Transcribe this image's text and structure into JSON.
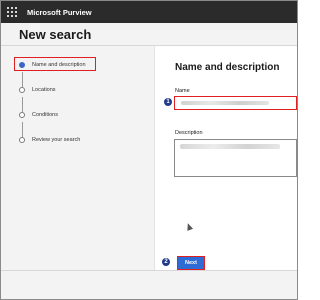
{
  "header": {
    "app_title": "Microsoft Purview"
  },
  "page": {
    "title": "New search"
  },
  "steps": [
    {
      "label": "Name and description",
      "active": true
    },
    {
      "label": "Locations",
      "active": false
    },
    {
      "label": "Conditions",
      "active": false
    },
    {
      "label": "Review your search",
      "active": false
    }
  ],
  "form": {
    "section_title": "Name and description",
    "name_label": "Name",
    "description_label": "Description"
  },
  "footer": {
    "next_label": "Next"
  },
  "callouts": {
    "one": "1",
    "two": "2"
  },
  "colors": {
    "accent": "#2f6bd4",
    "highlight": "#e02020",
    "badge": "#1f3a8a"
  }
}
